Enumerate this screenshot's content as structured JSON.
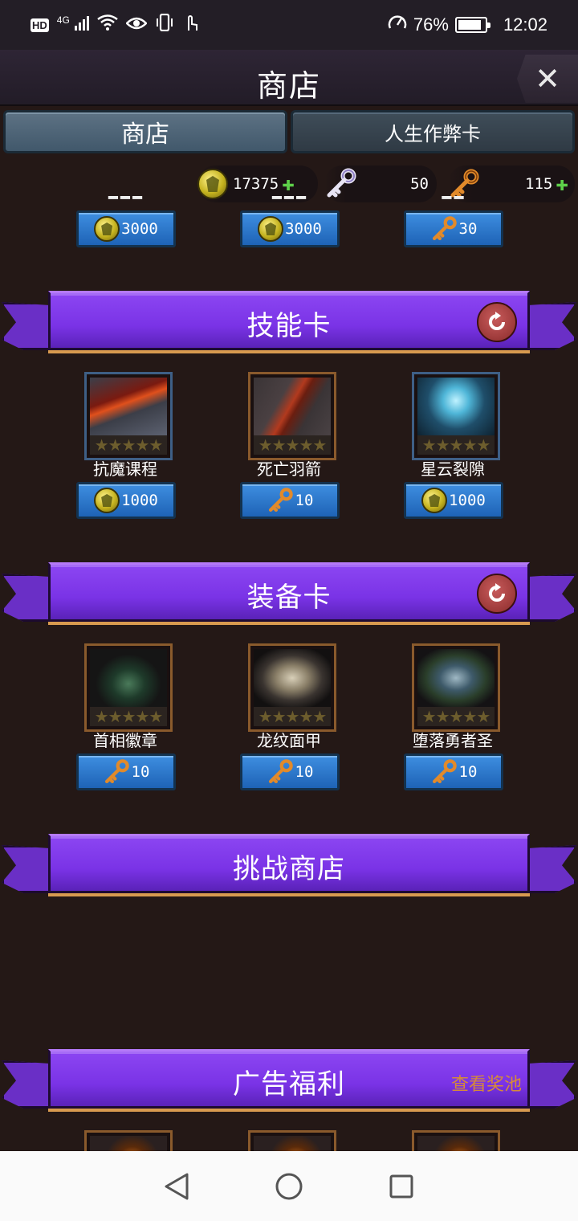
{
  "status_bar": {
    "hd": "HD",
    "network": "4G",
    "battery": "76%",
    "time": "12:02"
  },
  "header": {
    "title": "商店",
    "close_label": "✕"
  },
  "tabs": [
    {
      "label": "商店",
      "active": true
    },
    {
      "label": "人生作弊卡",
      "active": false
    }
  ],
  "currency": {
    "coins": "17375",
    "silver_keys": "50",
    "keys": "115"
  },
  "top_row_prices": [
    "3000",
    "3000",
    "30"
  ],
  "top_row_price_icons": [
    "coin-icon",
    "coin-icon",
    "key-icon"
  ],
  "sections": {
    "skill": {
      "title": "技能卡",
      "items": [
        {
          "name": "抗魔课程",
          "price": "1000",
          "currency": "coin"
        },
        {
          "name": "死亡羽箭",
          "price": "10",
          "currency": "key"
        },
        {
          "name": "星云裂隙",
          "price": "1000",
          "currency": "coin"
        }
      ]
    },
    "equipment": {
      "title": "装备卡",
      "items": [
        {
          "name": "首相徽章",
          "price": "10",
          "currency": "key"
        },
        {
          "name": "龙纹面甲",
          "price": "10",
          "currency": "key"
        },
        {
          "name": "堕落勇者圣",
          "price": "10",
          "currency": "key"
        }
      ]
    },
    "challenge": {
      "title": "挑战商店"
    },
    "ads": {
      "title": "广告福利",
      "link": "查看奖池"
    }
  },
  "stars": "★★★★★",
  "colors": {
    "ribbon": "#7a33e6",
    "price_button": "#2b78d0",
    "background": "#241816"
  }
}
